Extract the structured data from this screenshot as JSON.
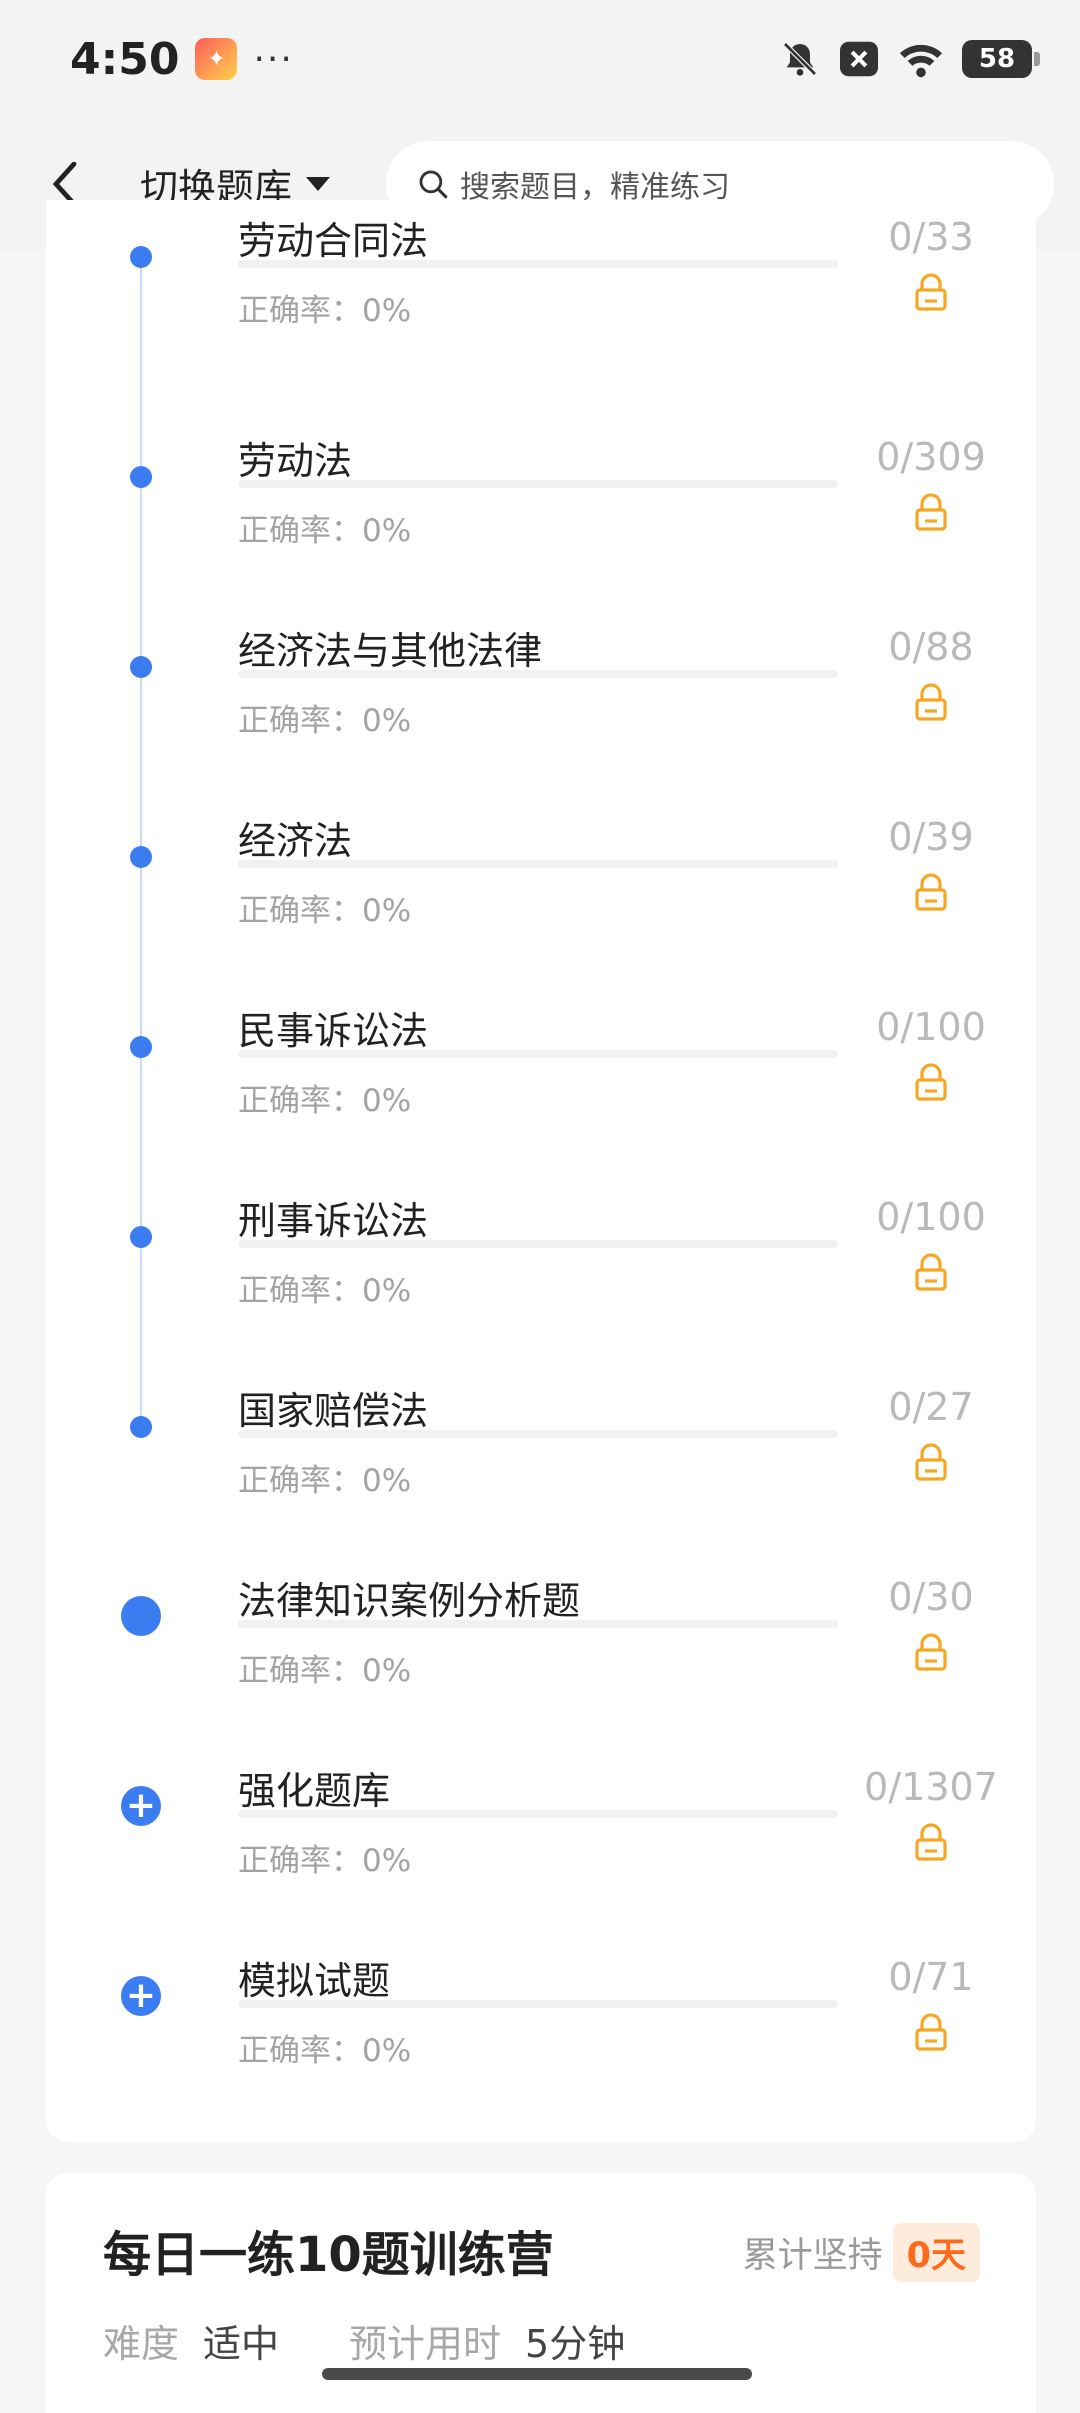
{
  "status_bar": {
    "time": "4:50",
    "more": "···",
    "battery": "58"
  },
  "nav": {
    "switch_label": "切换题库",
    "search_placeholder": "搜索题目，精准练习"
  },
  "accuracy_label": "正确率：0%",
  "items": [
    {
      "title": "劳动合同法",
      "count": "0/33",
      "marker": "dot"
    },
    {
      "title": "劳动法",
      "count": "0/309",
      "marker": "dot"
    },
    {
      "title": "经济法与其他法律",
      "count": "0/88",
      "marker": "dot"
    },
    {
      "title": "经济法",
      "count": "0/39",
      "marker": "dot"
    },
    {
      "title": "民事诉讼法",
      "count": "0/100",
      "marker": "dot"
    },
    {
      "title": "刑事诉讼法",
      "count": "0/100",
      "marker": "dot"
    },
    {
      "title": "国家赔偿法",
      "count": "0/27",
      "marker": "dot"
    },
    {
      "title": "法律知识案例分析题",
      "count": "0/30",
      "marker": "big-dot"
    },
    {
      "title": "强化题库",
      "count": "0/1307",
      "marker": "plus"
    },
    {
      "title": "模拟试题",
      "count": "0/71",
      "marker": "plus"
    }
  ],
  "camp": {
    "title": "每日一练10题训练营",
    "streak_label": "累计坚持",
    "streak_value": "0天",
    "difficulty_label": "难度",
    "difficulty_value": "适中",
    "time_label": "预计用时",
    "time_value": "5分钟"
  },
  "colors": {
    "accent": "#3b7cf0",
    "lock": "#f5a623",
    "badge_text": "#ff6a1a"
  }
}
